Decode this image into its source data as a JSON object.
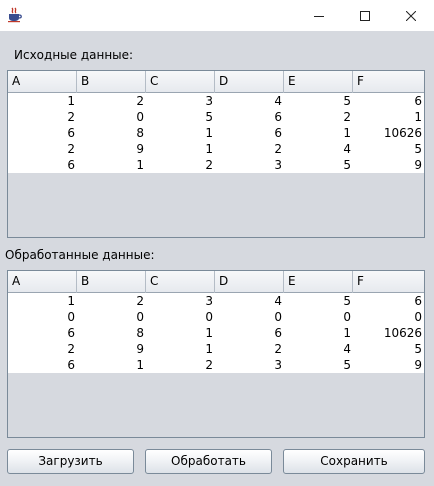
{
  "window": {
    "icon": "java-app-icon"
  },
  "source_section": {
    "label": "Исходные данные:",
    "columns": [
      "A",
      "B",
      "C",
      "D",
      "E",
      "F"
    ],
    "rows": [
      [
        "1",
        "2",
        "3",
        "4",
        "5",
        "6"
      ],
      [
        "2",
        "0",
        "5",
        "6",
        "2",
        "1"
      ],
      [
        "6",
        "8",
        "1",
        "6",
        "1",
        "10626"
      ],
      [
        "2",
        "9",
        "1",
        "2",
        "4",
        "5"
      ],
      [
        "6",
        "1",
        "2",
        "3",
        "5",
        "9"
      ]
    ]
  },
  "processed_section": {
    "label": "Обработанные данные:",
    "columns": [
      "A",
      "B",
      "C",
      "D",
      "E",
      "F"
    ],
    "rows": [
      [
        "1",
        "2",
        "3",
        "4",
        "5",
        "6"
      ],
      [
        "0",
        "0",
        "0",
        "0",
        "0",
        "0"
      ],
      [
        "6",
        "8",
        "1",
        "6",
        "1",
        "10626"
      ],
      [
        "2",
        "9",
        "1",
        "2",
        "4",
        "5"
      ],
      [
        "6",
        "1",
        "2",
        "3",
        "5",
        "9"
      ]
    ]
  },
  "buttons": {
    "load": "Загрузить",
    "process": "Обработать",
    "save": "Сохранить"
  }
}
